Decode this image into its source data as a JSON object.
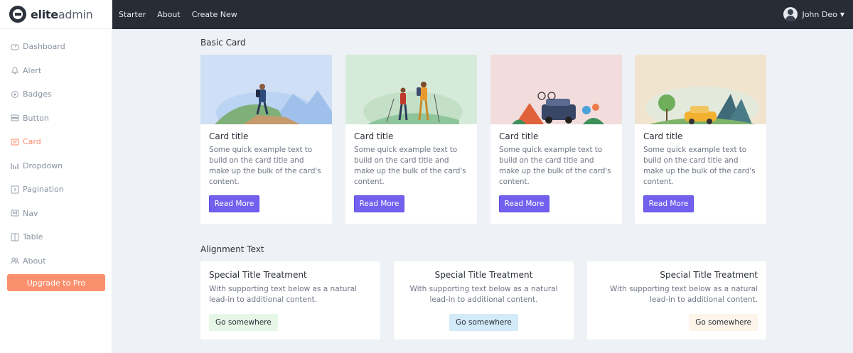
{
  "brand": {
    "bold": "elite",
    "light": "admin"
  },
  "sidebar": {
    "items": [
      {
        "label": "Dashboard",
        "icon": "dashboard-icon",
        "active": false
      },
      {
        "label": "Alert",
        "icon": "bell-icon",
        "active": false
      },
      {
        "label": "Badges",
        "icon": "badge-icon",
        "active": false
      },
      {
        "label": "Button",
        "icon": "button-icon",
        "active": false
      },
      {
        "label": "Card",
        "icon": "card-icon",
        "active": true
      },
      {
        "label": "Dropdown",
        "icon": "dropdown-icon",
        "active": false
      },
      {
        "label": "Pagination",
        "icon": "pagination-icon",
        "active": false
      },
      {
        "label": "Nav",
        "icon": "nav-icon",
        "active": false
      },
      {
        "label": "Table",
        "icon": "table-icon",
        "active": false
      },
      {
        "label": "About",
        "icon": "users-icon",
        "active": false
      }
    ],
    "upgrade_label": "Upgrade to Pro"
  },
  "topbar": {
    "links": [
      "Starter",
      "About",
      "Create New"
    ],
    "user_name": "John Deo"
  },
  "basic_card": {
    "section_title": "Basic Card",
    "cards": [
      {
        "title": "Card title",
        "text": "Some quick example text to build on the card title and make up the bulk of the card's content.",
        "button": "Read More",
        "bg": "#cfdff5"
      },
      {
        "title": "Card title",
        "text": "Some quick example text to build on the card title and make up the bulk of the card's content.",
        "button": "Read More",
        "bg": "#d6ead9"
      },
      {
        "title": "Card title",
        "text": "Some quick example text to build on the card title and make up the bulk of the card's content.",
        "button": "Read More",
        "bg": "#f2dcdc"
      },
      {
        "title": "Card title",
        "text": "Some quick example text to build on the card title and make up the bulk of the card's content.",
        "button": "Read More",
        "bg": "#f1e4cf"
      }
    ]
  },
  "alignment": {
    "section_title": "Alignment Text",
    "cards": [
      {
        "title": "Special Title Treatment",
        "text": "With supporting text below as a natural lead-in to additional content.",
        "button": "Go somewhere",
        "button_bg": "#e6f7e8"
      },
      {
        "title": "Special Title Treatment",
        "text": "With supporting text below as a natural lead-in to additional content.",
        "button": "Go somewhere",
        "button_bg": "#d3eaf8"
      },
      {
        "title": "Special Title Treatment",
        "text": "With supporting text below as a natural lead-in to additional content.",
        "button": "Go somewhere",
        "button_bg": "#fdf5ea"
      }
    ]
  },
  "colors": {
    "accent": "#fb8a6b",
    "primary_button": "#7460ee",
    "topbar": "#272c35"
  }
}
